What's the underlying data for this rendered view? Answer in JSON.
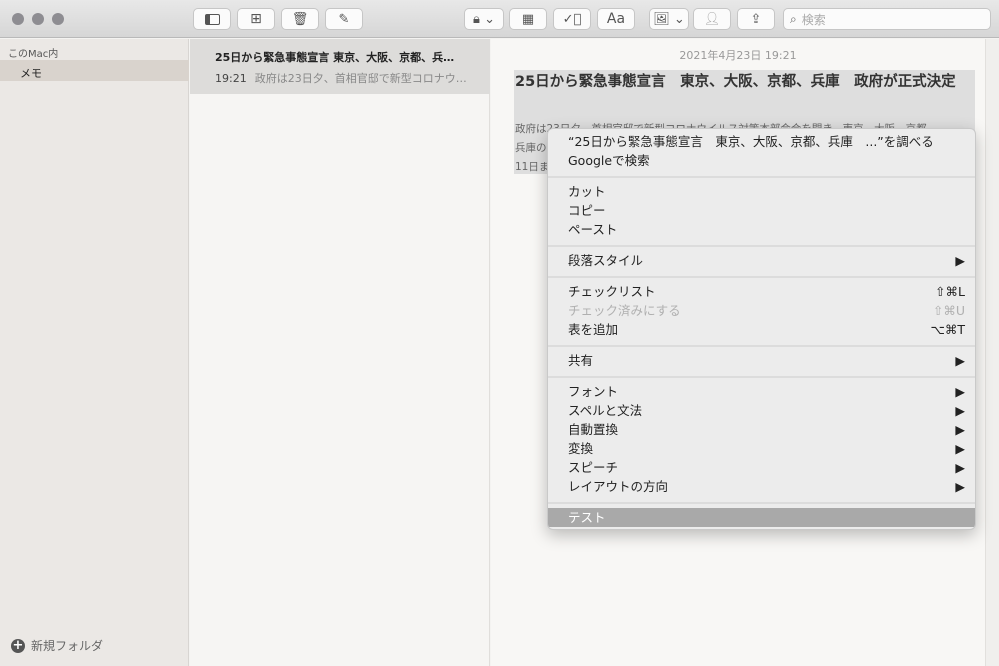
{
  "toolbar": {
    "search_placeholder": "検索",
    "format_label": "Aa",
    "icons": [
      "sidebar-icon",
      "gallery-icon",
      "trash-icon",
      "compose-icon",
      "lock-icon",
      "table-icon",
      "checklist-icon",
      "format-icon",
      "media-icon",
      "collaborate-icon",
      "share-icon",
      "search-icon"
    ]
  },
  "sidebar": {
    "section": "このMac内",
    "items": [
      {
        "label": "メモ",
        "selected": true
      }
    ],
    "new_folder": "新規フォルダ"
  },
  "list": {
    "notes": [
      {
        "title": "25日から緊急事態宣言 東京、大阪、京都、兵…",
        "time": "19:21",
        "preview": "政府は23日夕、首相官邸で新型コロナウ…"
      }
    ]
  },
  "editor": {
    "date": "2021年4月23日 19:21",
    "title": "25日から緊急事態宣言　東京、大阪、京都、兵庫　政府が正式決定",
    "body": [
      "政府は23日夕、首相官邸で新型コロナウイルス対策本部会合を開き、東京、大阪、京都",
      "兵庫の",
      "11日ま"
    ]
  },
  "menu": {
    "lookup": "“25日から緊急事態宣言　東京、大阪、京都、兵庫　...”を調べる",
    "google": "Googleで検索",
    "cut": "カット",
    "copy": "コピー",
    "paste": "ペースト",
    "paragraph_style": "段落スタイル",
    "checklist": "チェックリスト",
    "checklist_sc": "⇧⌘L",
    "mark_checked": "チェック済みにする",
    "mark_checked_sc": "⇧⌘U",
    "add_table": "表を追加",
    "add_table_sc": "⌥⌘T",
    "share": "共有",
    "font": "フォント",
    "spelling": "スペルと文法",
    "substitutions": "自動置換",
    "transformations": "変換",
    "speech": "スピーチ",
    "layout_direction": "レイアウトの方向",
    "test": "テスト",
    "submenu_arrow": "▶"
  }
}
